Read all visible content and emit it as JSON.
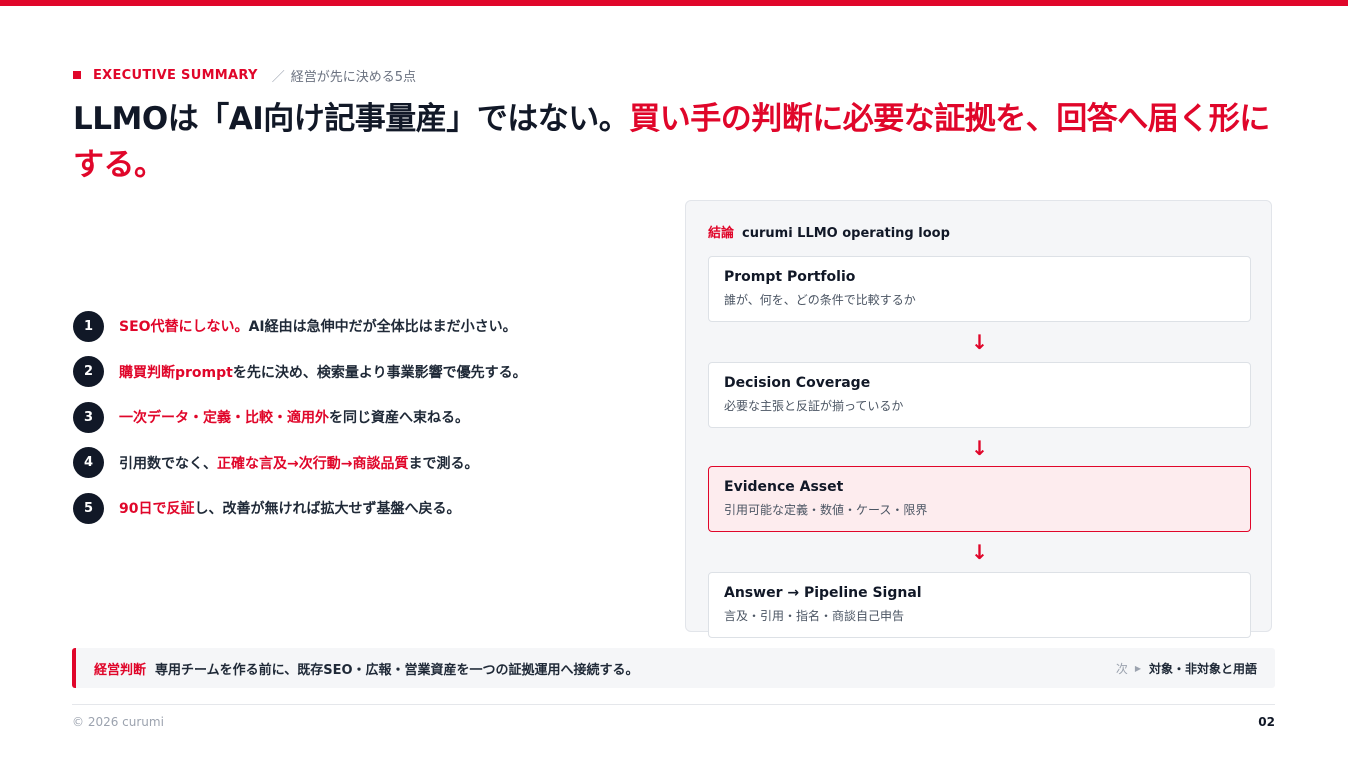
{
  "eyebrow": {
    "en": "EXECUTIVE SUMMARY",
    "sep": "／",
    "jp": "経営が先に決める5点"
  },
  "headline": {
    "part1": "LLMOは「AI向け記事量産」ではない。",
    "part2": "買い手の判断に必要な証拠を、回答へ届く形にする。"
  },
  "points": [
    {
      "num": "1",
      "red": "SEO代替にしない。",
      "rest": "AI経由は急伸中だが全体比はまだ小さい。"
    },
    {
      "num": "2",
      "red": "購買判断prompt",
      "rest": "を先に決め、検索量より事業影響で優先する。"
    },
    {
      "num": "3",
      "red": "一次データ・定義・比較・適用外",
      "rest": "を同じ資産へ束ねる。"
    },
    {
      "num": "4",
      "pre": "引用数でなく、",
      "red": "正確な言及→次行動→商談品質",
      "rest": "まで測る。"
    },
    {
      "num": "5",
      "red": "90日で反証",
      "rest": "し、改善が無ければ拡大せず基盤へ戻る。"
    }
  ],
  "panel": {
    "label": "結論",
    "title": "curumi LLMO operating loop",
    "arrow": "↓",
    "cards": [
      {
        "title": "Prompt Portfolio",
        "sub": "誰が、何を、どの条件で比較するか"
      },
      {
        "title": "Decision Coverage",
        "sub": "必要な主張と反証が揃っているか"
      },
      {
        "title": "Evidence Asset",
        "sub": "引用可能な定義・数値・ケース・限界"
      },
      {
        "title": "Answer → Pipeline Signal",
        "sub": "言及・引用・指名・商談自己申告"
      }
    ]
  },
  "decision": {
    "label": "経営判断",
    "text": "専用チームを作る前に、既存SEO・広報・営業資産を一つの証拠運用へ接続する。",
    "next_label": "次",
    "next_text": "対象・非対象と用語"
  },
  "footer": {
    "copyright": "© 2026 curumi",
    "page": "02"
  },
  "colors": {
    "accent": "#e0062a",
    "text": "#111827",
    "panel_bg": "#f5f6f8",
    "highlight_bg": "#fdecee"
  }
}
